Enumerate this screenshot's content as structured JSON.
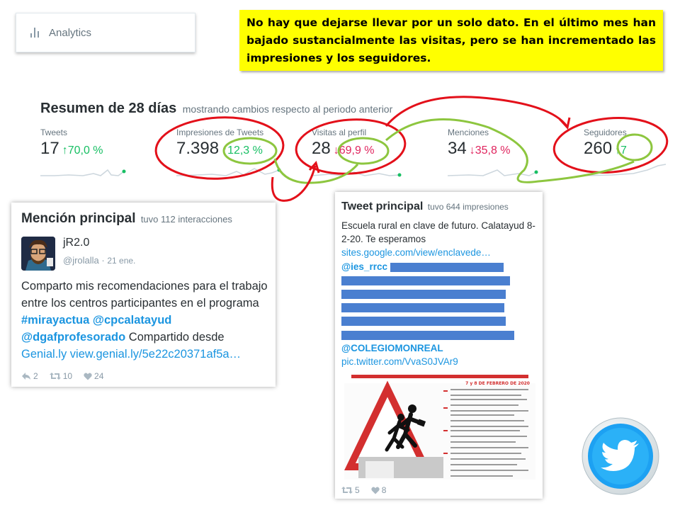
{
  "analytics_tab": {
    "label": "Analytics"
  },
  "note": {
    "text": "No hay que dejarse llevar por un solo dato. En el último mes han bajado sustancialmente las visitas, pero se han incrementado las impresiones y los seguidores."
  },
  "summary": {
    "title": "Resumen de 28 días",
    "subtitle": "mostrando cambios respecto al periodo anterior",
    "stats": [
      {
        "label": "Tweets",
        "value": "17",
        "change": "70,0 %",
        "direction": "up"
      },
      {
        "label": "Impresiones de Tweets",
        "value": "7.398",
        "change": "12,3 %",
        "direction": "up"
      },
      {
        "label": "Visitas al perfil",
        "value": "28",
        "change": "69,9 %",
        "direction": "down"
      },
      {
        "label": "Menciones",
        "value": "34",
        "change": "35,8 %",
        "direction": "down"
      },
      {
        "label": "Seguidores",
        "value": "260",
        "change": "7",
        "direction": "up"
      }
    ]
  },
  "mention": {
    "title": "Mención principal",
    "subtitle": "tuvo 112 interacciones",
    "user": {
      "name": "jR2.0",
      "handle": "@jrolalla",
      "date": "21 ene."
    },
    "body": {
      "t1": "Comparto mis recomendaciones para el trabajo entre los centros participantes en el programa ",
      "tag": "#mirayactua",
      "sp": " ",
      "m1": "@cpcalatayud",
      "m2": "@dgafprofesorado",
      "t2": " Compartido desde ",
      "l1": "Genial.ly",
      "l2": "view.genial.ly/5e22c20371af5a…"
    },
    "actions": {
      "replies": "2",
      "retweets": "10",
      "likes": "24"
    }
  },
  "tweet": {
    "title": "Tweet principal",
    "subtitle": "tuvo 644 impresiones",
    "text": "Escuela rural en clave de futuro. Calatayud 8-2-20. Te esperamos",
    "link": "sites.google.com/view/enclavede…",
    "mentions": {
      "ies": "@ies_rrcc",
      "colegio": "@COLEGIOMONREAL"
    },
    "pic": "pic.twitter.com/VvaS0JVAr9",
    "poster_date": "7 y 8 DE FEBRERO DE 2020",
    "actions": {
      "retweets": "5",
      "likes": "8"
    }
  },
  "colors": {
    "up": "#17bf63",
    "down": "#e0245e",
    "link": "#1b95e0",
    "note_bg": "#ffff00",
    "annotation_red": "#e3101a",
    "annotation_green": "#8dc63f"
  }
}
